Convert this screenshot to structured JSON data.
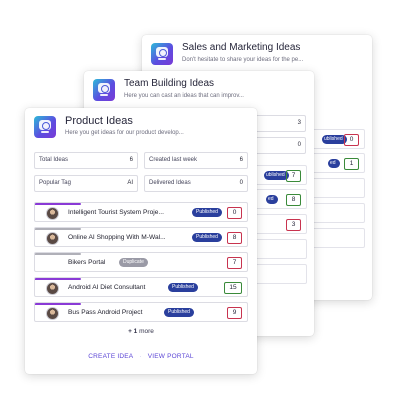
{
  "colors": {
    "brand_gradient": [
      "#2dbbd8",
      "#5b4ee0",
      "#7a3ad6"
    ],
    "published_badge": "#2a3f9d",
    "duplicate_badge": "#9a9aa6",
    "link": "#5b45d6",
    "vote_red": "#c8334f",
    "vote_green": "#3a8a3a",
    "accent_purple": "#8a3ad6",
    "accent_gray": "#b0b0b8"
  },
  "back_card": {
    "title": "Sales and Marketing Ideas",
    "subtitle": "Don't hesitate to share your ideas for the pe...",
    "stat_values": [
      "2",
      "0"
    ],
    "votes": [
      "0",
      "1"
    ],
    "badges": [
      "ublished",
      "ed"
    ]
  },
  "mid_card": {
    "title": "Team Building Ideas",
    "subtitle": "Here you can cast an ideas that can improv...",
    "stat_labels": [
      "ek",
      ""
    ],
    "stat_values": [
      "3",
      "0"
    ],
    "votes": [
      "7",
      "8",
      "3"
    ],
    "badges": [
      "ublished",
      "ed"
    ]
  },
  "front_card": {
    "title": "Product Ideas",
    "subtitle": "Here you get ideas for our product develop...",
    "stats": [
      {
        "label": "Total Ideas",
        "value": "6"
      },
      {
        "label": "Created last week",
        "value": "6"
      },
      {
        "label": "Popular Tag",
        "value": "AI"
      },
      {
        "label": "Delivered Ideas",
        "value": "0"
      }
    ],
    "ideas": [
      {
        "name": "Intelligent Tourist System Proje...",
        "status": "Published",
        "votes": "0",
        "vote_color": "red",
        "accent": "purple"
      },
      {
        "name": "Online AI Shopping With M-Wal...",
        "status": "Published",
        "votes": "8",
        "vote_color": "red",
        "accent": "gray"
      },
      {
        "name": "Bikers Portal",
        "status": "Duplicate",
        "votes": "7",
        "vote_color": "red",
        "accent": "gray"
      },
      {
        "name": "Android AI Diet Consultant",
        "status": "Published",
        "votes": "15",
        "vote_color": "green",
        "accent": "purple"
      },
      {
        "name": "Bus Pass Android Project",
        "status": "Published",
        "votes": "9",
        "vote_color": "red",
        "accent": "purple"
      }
    ],
    "more_count": "+ 1",
    "more_label": "more",
    "create_label": "CREATE IDEA",
    "separator": "·",
    "portal_label": "VIEW PORTAL"
  }
}
